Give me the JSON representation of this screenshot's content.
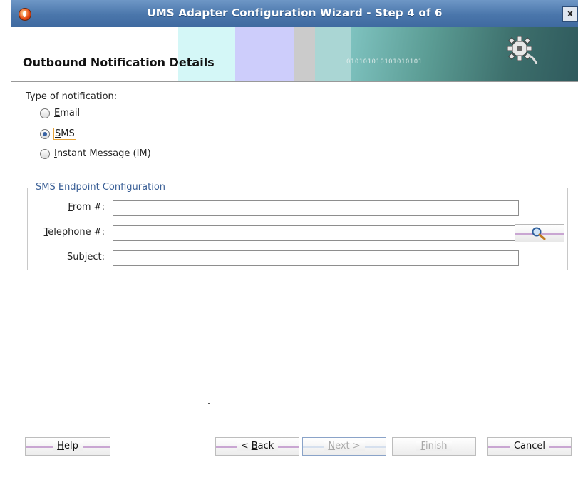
{
  "window": {
    "title": "UMS Adapter Configuration Wizard - Step 4 of 6",
    "close_glyph": "x"
  },
  "header": {
    "title": "Outbound Notification Details",
    "banner_text": "010101010101010101"
  },
  "notification_type": {
    "label": "Type of notification:",
    "options": [
      {
        "mnemonic": "E",
        "rest": "mail",
        "selected": false
      },
      {
        "mnemonic": "S",
        "rest": "MS",
        "selected": true
      },
      {
        "mnemonic": "I",
        "rest": "nstant Message (IM)",
        "selected": false
      }
    ]
  },
  "sms_config": {
    "legend": "SMS Endpoint Configuration",
    "from": {
      "mnemonic": "F",
      "rest": "rom #:",
      "value": ""
    },
    "telephone": {
      "mnemonic": "T",
      "rest": "elephone #:",
      "value": ""
    },
    "subject": {
      "before": "Sub",
      "mnemonic": "j",
      "after": "ect:",
      "value": ""
    }
  },
  "buttons": {
    "help": {
      "mnemonic": "H",
      "rest": "elp"
    },
    "back": {
      "prefix": "< ",
      "mnemonic": "B",
      "rest": "ack"
    },
    "next": {
      "mnemonic": "N",
      "rest": "ext >"
    },
    "finish": {
      "mnemonic": "F",
      "rest": "inish"
    },
    "cancel": {
      "label": "Cancel"
    }
  },
  "colors": {
    "title_bar": "#4a76ab",
    "legend_text": "#3a5f96",
    "focus_outline": "#e8a43a",
    "button_band": "#c9a6d2"
  }
}
